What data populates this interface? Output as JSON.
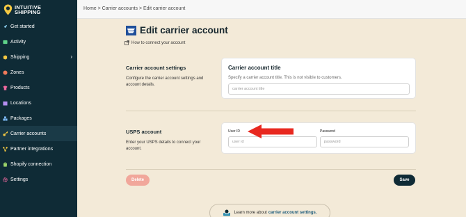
{
  "brand": {
    "line1": "INTUITIVE",
    "line2": "SHIPPING"
  },
  "breadcrumb": "Home > Carrier accounts > Edit carrier account",
  "sidebar": {
    "items": [
      {
        "label": "Get started",
        "icon": "rocket-icon",
        "color": "#8fd3f4"
      },
      {
        "label": "Activity",
        "icon": "activity-icon",
        "color": "#5fd38a"
      },
      {
        "label": "Shipping",
        "icon": "box-icon",
        "color": "#f4c842"
      },
      {
        "label": "Zones",
        "icon": "globe-icon",
        "color": "#f07a5a"
      },
      {
        "label": "Products",
        "icon": "shirt-icon",
        "color": "#f06aa0"
      },
      {
        "label": "Locations",
        "icon": "store-icon",
        "color": "#b58ef0"
      },
      {
        "label": "Packages",
        "icon": "packages-icon",
        "color": "#7ab6f0"
      },
      {
        "label": "Carrier accounts",
        "icon": "key-icon",
        "color": "#f4c842"
      },
      {
        "label": "Partner integrations",
        "icon": "network-icon",
        "color": "#f4c842"
      },
      {
        "label": "Shopify connection",
        "icon": "shopify-icon",
        "color": "#9bd36a"
      },
      {
        "label": "Settings",
        "icon": "gear-icon",
        "color": "#f06aa0"
      }
    ],
    "active": "Carrier accounts"
  },
  "main": {
    "title": "Edit carrier account",
    "help_link": "How to connect your account",
    "settings_section": {
      "title": "Carrier account settings",
      "description": "Configure the carrier account settings and account details."
    },
    "title_card": {
      "title": "Carrier account title",
      "subtitle": "Specify a carrier account title. This is not visible to customers.",
      "placeholder": "carrier account title"
    },
    "usps_section": {
      "title": "USPS account",
      "description": "Enter your USPS details to connect your account."
    },
    "usps_card": {
      "user_id_label": "User ID",
      "user_id_placeholder": "user id",
      "password_label": "Password",
      "password_placeholder": "password"
    },
    "delete_label": "Delete",
    "save_label": "Save",
    "learn_more_prefix": "Learn more about",
    "learn_more_link": "carrier account settings."
  },
  "colors": {
    "sidebar_bg": "#0f2b36",
    "page_bg": "#f3ead8",
    "delete": "#f1a79b",
    "save": "#0f2b36",
    "arrow": "#e8281f"
  }
}
